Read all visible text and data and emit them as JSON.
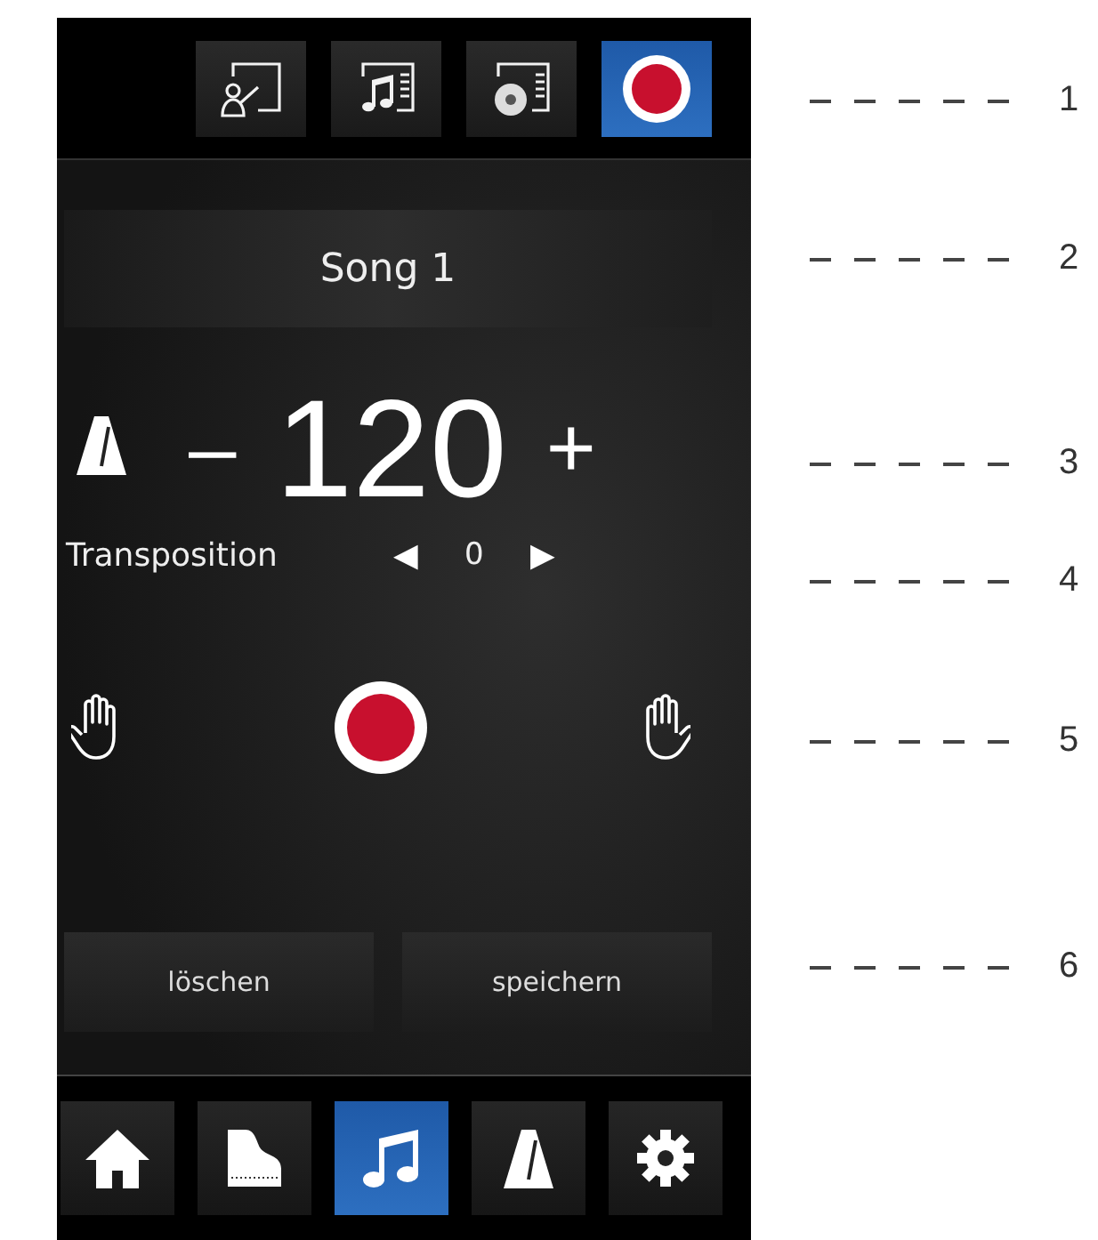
{
  "top_tabs": [
    {
      "kind": "teacher",
      "selected": false
    },
    {
      "kind": "songlist",
      "selected": false
    },
    {
      "kind": "cd",
      "selected": false
    },
    {
      "kind": "record",
      "selected": true
    }
  ],
  "song_button": "Song 1",
  "tempo": {
    "minus": "–",
    "value": "120",
    "plus": "+"
  },
  "transposition": {
    "label": "Transposition",
    "left": "◀",
    "value": "0",
    "right": "▶"
  },
  "actions": [
    "löschen",
    "speichern"
  ],
  "bottom_nav": [
    {
      "kind": "home",
      "selected": false
    },
    {
      "kind": "piano",
      "selected": false
    },
    {
      "kind": "music",
      "selected": true
    },
    {
      "kind": "metronome",
      "selected": false
    },
    {
      "kind": "settings",
      "selected": false
    }
  ],
  "callouts": [
    "1",
    "2",
    "3",
    "4",
    "5",
    "6"
  ]
}
